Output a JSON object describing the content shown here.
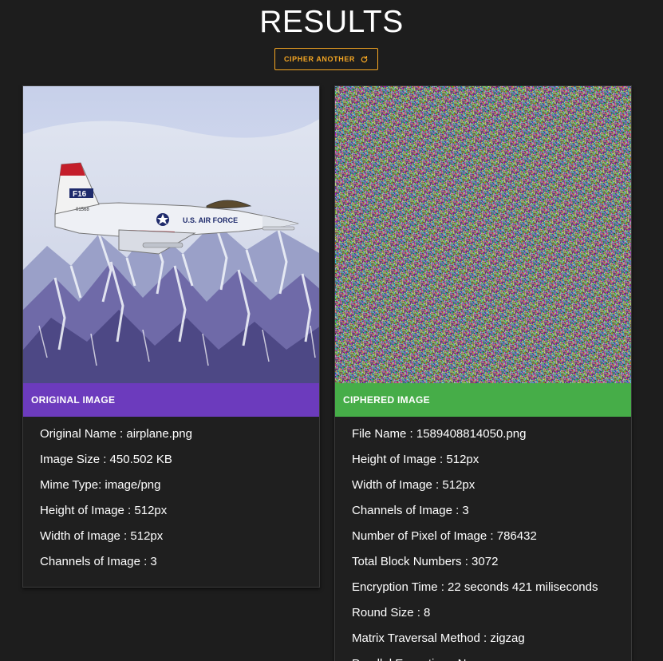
{
  "page": {
    "title": "RESULTS"
  },
  "actions": {
    "cipher_another_label": "CIPHER ANOTHER",
    "cipher_another_icon": "refresh-icon"
  },
  "original": {
    "header": "ORIGINAL IMAGE",
    "image_alt": "F-16 jet fighter flying over snowy mountains",
    "info": [
      "Original Name : airplane.png",
      "Image Size : 450.502 KB",
      "Mime Type: image/png",
      "Height of Image : 512px",
      "Width of Image : 512px",
      "Channels of Image : 3"
    ]
  },
  "ciphered": {
    "header": "CIPHERED IMAGE",
    "info": [
      "File Name : 1589408814050.png",
      "Height of Image : 512px",
      "Width of Image : 512px",
      "Channels of Image : 3",
      "Number of Pixel of Image : 786432",
      "Total Block Numbers : 3072",
      "Encryption Time : 22 seconds 421 miliseconds",
      "Round Size : 8",
      "Matrix Traversal Method : zigzag",
      "Parallel Execution : No"
    ]
  },
  "colors": {
    "background": "#1d1d1d",
    "accent_button": "#f5a623",
    "original_header": "#6c3bbd",
    "ciphered_header": "#46ad48"
  }
}
